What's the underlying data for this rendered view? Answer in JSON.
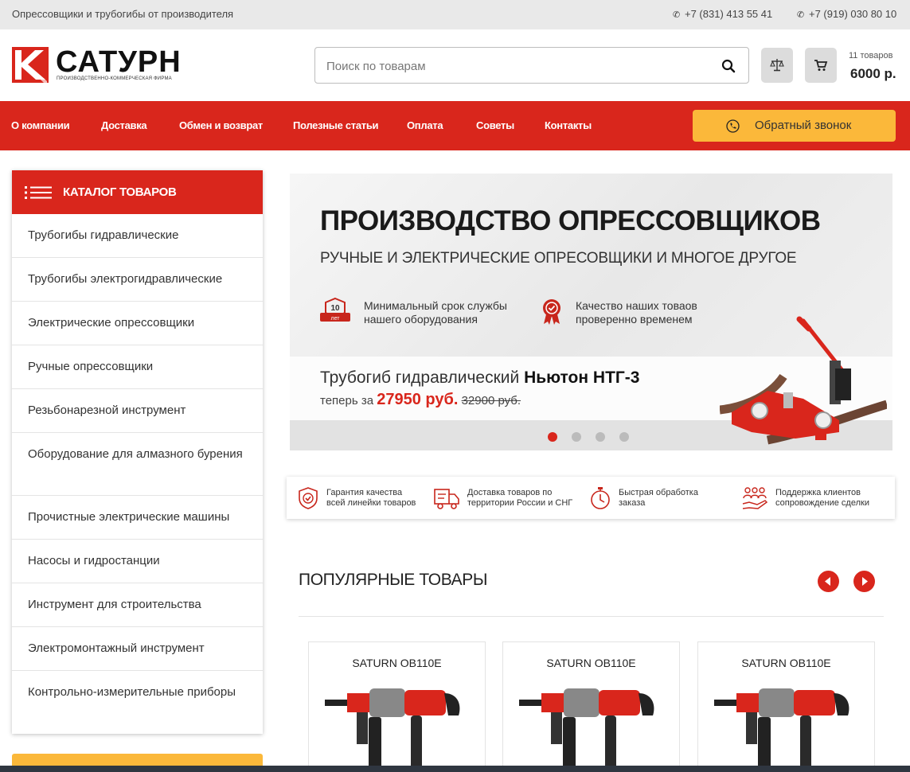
{
  "topbar": {
    "tagline": "Опрессовщики и трубогибы от производителя",
    "phone1": "+7 (831) 413 55 41",
    "phone2": "+7 (919) 030 80 10"
  },
  "header": {
    "logo_text": "САТУРН",
    "logo_sub": "ПРОИЗВОДСТВЕННО-КОММЕРЧЕСКАЯ ФИРМА",
    "search_placeholder": "Поиск по товарам",
    "cart_count": "11 товаров",
    "cart_sum": "6000 р."
  },
  "nav": {
    "items": [
      "О компании",
      "Доставка",
      "Обмен и возврат",
      "Полезные статьи",
      "Оплата",
      "Советы",
      "Контакты"
    ],
    "callback": "Обратный звонок"
  },
  "catalog": {
    "title": "КАТАЛОГ ТОВАРОВ",
    "items": [
      "Трубогибы гидравлические",
      "Трубогибы электрогидравлические",
      "Электрические опрессовщики",
      "Ручные опрессовщики",
      "Резьбонарезной инструмент",
      "Оборудование для алмазного бурения",
      "Прочистные электрические машины",
      "Насосы и гидростанции",
      "Инструмент для строительства",
      "Электромонтажный инструмент",
      "Контрольно-измерительные приборы"
    ]
  },
  "banner": {
    "title": "ПРОИЗВОДСТВО ОПРЕССОВЩИКОВ",
    "subtitle": "РУЧНЫЕ И ЭЛЕКТРИЧЕСКИЕ ОПРЕСОВЩИКИ И МНОГОЕ ДРУГОЕ",
    "feature1_line1": "Минимальный срок службы",
    "feature1_line2": "нашего оборудования",
    "feature1_badge_num": "10",
    "feature1_badge_word": "лет",
    "feature2_line1": "Качество наших товаов",
    "feature2_line2": "проверенно временем",
    "product_prefix": "Трубогиб гидравлический ",
    "product_name": "Ньютон НТГ-3",
    "price_prefix": "теперь за ",
    "price_new": "27950 руб.",
    "price_old": "32900 руб.",
    "slides": 4,
    "active_slide": 1
  },
  "advantages": [
    {
      "line1": "Гарантия качества",
      "line2": "всей линейки товаров",
      "icon": "shield-check-icon"
    },
    {
      "line1": "Доставка товаров по",
      "line2": "территории России и СНГ",
      "icon": "delivery-truck-icon"
    },
    {
      "line1": "Быстрая обработка",
      "line2": "заказа",
      "icon": "stopwatch-icon"
    },
    {
      "line1": "Поддержка клиентов",
      "line2": "сопровождение сделки",
      "icon": "support-hand-icon"
    }
  ],
  "popular": {
    "title": "ПОПУЛЯРНЫЕ ТОВАРЫ",
    "products": [
      {
        "name": "SATURN OB110E"
      },
      {
        "name": "SATURN OB110E"
      },
      {
        "name": "SATURN OB110E"
      }
    ]
  },
  "colors": {
    "accent": "#d9261c",
    "yellow": "#fbb83a",
    "topbar": "#e9e9e9"
  }
}
